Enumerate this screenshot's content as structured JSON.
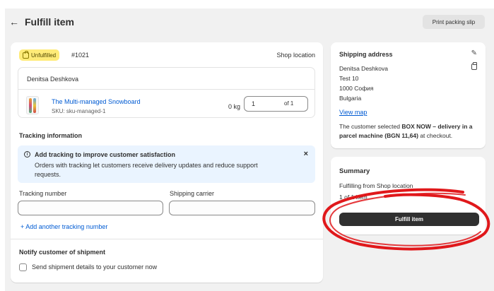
{
  "header": {
    "back_icon": "arrow-left-icon",
    "title": "Fulfill item",
    "print_button": "Print packing slip"
  },
  "order": {
    "status_badge": "Unfulfilled",
    "status_icon": "package-icon",
    "number": "#1021",
    "location": "Shop location",
    "customer": "Denitsa Deshkova",
    "product": {
      "name": "The Multi-managed Snowboard",
      "sku": "SKU: sku-managed-1",
      "weight": "0 kg",
      "quantity": "1",
      "quantity_of": "of 1"
    }
  },
  "tracking": {
    "title": "Tracking information",
    "banner_title": "Add tracking to improve customer satisfaction",
    "banner_text": "Orders with tracking let customers receive delivery updates and reduce support requests.",
    "tracking_number_label": "Tracking number",
    "tracking_number_value": "",
    "carrier_label": "Shipping carrier",
    "carrier_value": "",
    "add_another": "+ Add another tracking number"
  },
  "notify": {
    "title": "Notify customer of shipment",
    "checkbox_label": "Send shipment details to your customer now",
    "checked": false
  },
  "shipping_address": {
    "title": "Shipping address",
    "lines": [
      "Denitsa Deshkova",
      "Test 10",
      "1000 София",
      "Bulgaria"
    ],
    "view_map": "View map",
    "note_prefix": "The customer selected ",
    "note_bold": "BOX NOW – delivery in a parcel machine (BGN 11,64)",
    "note_suffix": " at checkout."
  },
  "summary": {
    "title": "Summary",
    "fulfilling_from": "Fulfilling from Shop location",
    "count": "1 of 1 item",
    "fulfill_button": "Fulfill item"
  },
  "colors": {
    "accent_link": "#005bd3",
    "badge_bg": "#ffeb78",
    "banner_bg": "#eaf4ff",
    "primary_button": "#303030",
    "annotation": "#e0181b"
  }
}
